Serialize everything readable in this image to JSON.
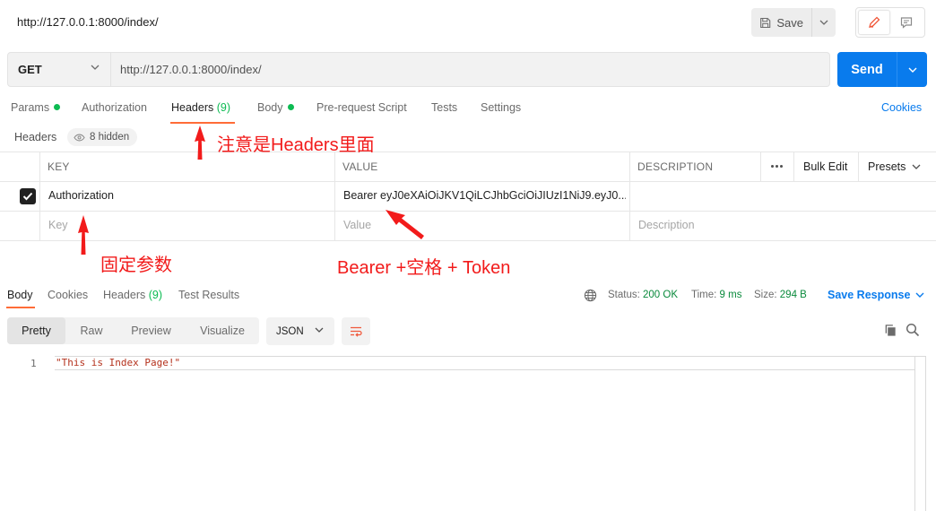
{
  "window": {
    "title": "http://127.0.0.1:8000/index/",
    "save_label": "Save"
  },
  "request": {
    "method": "GET",
    "url": "http://127.0.0.1:8000/index/",
    "send_label": "Send"
  },
  "tabs": {
    "params": "Params",
    "authorization": "Authorization",
    "headers": "Headers",
    "headers_count": "(9)",
    "body": "Body",
    "pre_request": "Pre-request Script",
    "tests": "Tests",
    "settings": "Settings",
    "cookies": "Cookies"
  },
  "headers_section": {
    "label": "Headers",
    "hidden": "8 hidden"
  },
  "table": {
    "columns": {
      "key": "KEY",
      "value": "VALUE",
      "description": "DESCRIPTION"
    },
    "bulk_edit": "Bulk Edit",
    "presets": "Presets",
    "rows": [
      {
        "key": "Authorization",
        "value": "Bearer eyJ0eXAiOiJKV1QiLCJhbGciOiJIUzI1NiJ9.eyJ0...",
        "description": "",
        "checked": true
      }
    ],
    "placeholders": {
      "key": "Key",
      "value": "Value",
      "description": "Description"
    }
  },
  "annotations": {
    "headers_note": "注意是Headers里面",
    "fixed_param": "固定参数",
    "bearer_token": "Bearer +空格 + Token"
  },
  "response": {
    "tabs": {
      "body": "Body",
      "cookies": "Cookies",
      "headers": "Headers",
      "headers_count": "(9)",
      "test_results": "Test Results"
    },
    "status_label": "Status:",
    "status_value": "200 OK",
    "time_label": "Time:",
    "time_value": "9 ms",
    "size_label": "Size:",
    "size_value": "294 B",
    "save_response": "Save Response",
    "views": [
      "Pretty",
      "Raw",
      "Preview",
      "Visualize"
    ],
    "format": "JSON",
    "lines": [
      {
        "no": "1",
        "text": "\"This is Index Page!\""
      }
    ]
  },
  "colors": {
    "accent_blue": "#097bed",
    "active_tab": "#ff6c37",
    "green": "#0cbb52",
    "annotation_red": "#f21b1b"
  }
}
